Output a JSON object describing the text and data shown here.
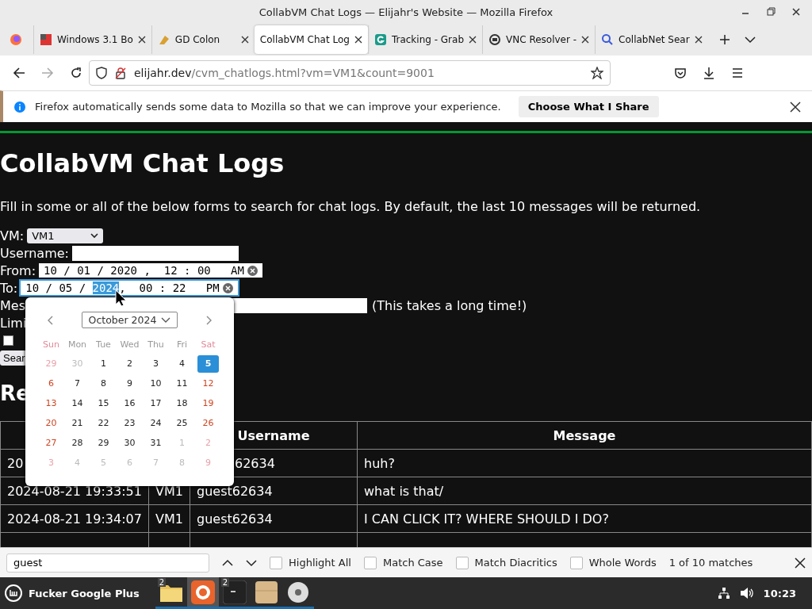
{
  "window": {
    "title": "CollabVM Chat Logs — Elijahr's Website — Mozilla Firefox"
  },
  "tabs": [
    {
      "label": "Windows 3.1 Bo",
      "selected": false
    },
    {
      "label": "GD Colon",
      "selected": false
    },
    {
      "label": "CollabVM Chat Log",
      "selected": true
    },
    {
      "label": "Tracking - Grab",
      "selected": false
    },
    {
      "label": "VNC Resolver -",
      "selected": false
    },
    {
      "label": "CollabNet Sear",
      "selected": false
    }
  ],
  "address": {
    "host": "elijahr.dev",
    "path": "/cvm_chatlogs.html?vm=VM1&count=9001"
  },
  "notification": {
    "text": "Firefox automatically sends some data to Mozilla so that we can improve your experience.",
    "button": "Choose What I Share"
  },
  "page": {
    "title": "CollabVM Chat Logs",
    "intro": "Fill in some or all of the below forms to search for chat logs. By default, the last 10 messages will be returned.",
    "vm_label": "VM:",
    "vm_value": "VM1",
    "username_label": "Username:",
    "from_label": "From:",
    "from_value": "10 / 01 / 2020 ,  12 : 00   AM",
    "to_label": "To:",
    "to_before": "10 / 05 / ",
    "to_highlight": "2024",
    "to_after": ",  00 : 22   PM",
    "message_label": "Mes",
    "message_note": "(This takes a long time!)",
    "limit_label": "Limi",
    "checked": false,
    "search_button": "Sear",
    "results_heading": "Re"
  },
  "calendar": {
    "month": "October 2024",
    "weekdays": [
      {
        "label": "Sun",
        "weekend": true
      },
      {
        "label": "Mon",
        "weekend": false
      },
      {
        "label": "Tue",
        "weekend": false
      },
      {
        "label": "Wed",
        "weekend": false
      },
      {
        "label": "Thu",
        "weekend": false
      },
      {
        "label": "Fri",
        "weekend": false
      },
      {
        "label": "Sat",
        "weekend": true
      }
    ],
    "weeks": [
      [
        {
          "day": "29",
          "muted": true,
          "selected": false
        },
        {
          "day": "30",
          "muted": true,
          "selected": false
        },
        {
          "day": "1",
          "muted": false,
          "selected": false
        },
        {
          "day": "2",
          "muted": false,
          "selected": false
        },
        {
          "day": "3",
          "muted": false,
          "selected": false
        },
        {
          "day": "4",
          "muted": false,
          "selected": false
        },
        {
          "day": "5",
          "muted": false,
          "selected": true
        }
      ],
      [
        {
          "day": "6",
          "muted": false,
          "selected": false
        },
        {
          "day": "7",
          "muted": false,
          "selected": false
        },
        {
          "day": "8",
          "muted": false,
          "selected": false
        },
        {
          "day": "9",
          "muted": false,
          "selected": false
        },
        {
          "day": "10",
          "muted": false,
          "selected": false
        },
        {
          "day": "11",
          "muted": false,
          "selected": false
        },
        {
          "day": "12",
          "muted": false,
          "selected": false
        }
      ],
      [
        {
          "day": "13",
          "muted": false,
          "selected": false
        },
        {
          "day": "14",
          "muted": false,
          "selected": false
        },
        {
          "day": "15",
          "muted": false,
          "selected": false
        },
        {
          "day": "16",
          "muted": false,
          "selected": false
        },
        {
          "day": "17",
          "muted": false,
          "selected": false
        },
        {
          "day": "18",
          "muted": false,
          "selected": false
        },
        {
          "day": "19",
          "muted": false,
          "selected": false
        }
      ],
      [
        {
          "day": "20",
          "muted": false,
          "selected": false
        },
        {
          "day": "21",
          "muted": false,
          "selected": false
        },
        {
          "day": "22",
          "muted": false,
          "selected": false
        },
        {
          "day": "23",
          "muted": false,
          "selected": false
        },
        {
          "day": "24",
          "muted": false,
          "selected": false
        },
        {
          "day": "25",
          "muted": false,
          "selected": false
        },
        {
          "day": "26",
          "muted": false,
          "selected": false
        }
      ],
      [
        {
          "day": "27",
          "muted": false,
          "selected": false
        },
        {
          "day": "28",
          "muted": false,
          "selected": false
        },
        {
          "day": "29",
          "muted": false,
          "selected": false
        },
        {
          "day": "30",
          "muted": false,
          "selected": false
        },
        {
          "day": "31",
          "muted": false,
          "selected": false
        },
        {
          "day": "1",
          "muted": true,
          "selected": false
        },
        {
          "day": "2",
          "muted": true,
          "selected": false
        }
      ],
      [
        {
          "day": "3",
          "muted": true,
          "selected": false
        },
        {
          "day": "4",
          "muted": true,
          "selected": false
        },
        {
          "day": "5",
          "muted": true,
          "selected": false
        },
        {
          "day": "6",
          "muted": true,
          "selected": false
        },
        {
          "day": "7",
          "muted": true,
          "selected": false
        },
        {
          "day": "8",
          "muted": true,
          "selected": false
        },
        {
          "day": "9",
          "muted": true,
          "selected": false
        }
      ]
    ]
  },
  "table": {
    "columns": [
      "",
      "",
      "Username",
      "Message"
    ],
    "rows": [
      [
        "20",
        "",
        "62634",
        "huh?"
      ],
      [
        "2024-08-21 19:33:51",
        "VM1",
        "guest62634",
        "what is that/"
      ],
      [
        "2024-08-21 19:34:07",
        "VM1",
        "guest62634",
        "I CAN CLICK IT? WHERE SHOULD I DO?"
      ],
      [
        "",
        "",
        "",
        ""
      ]
    ]
  },
  "find_bar": {
    "query": "guest",
    "options": [
      {
        "label": "Highlight All",
        "checked": false
      },
      {
        "label": "Match Case",
        "checked": false
      },
      {
        "label": "Match Diacritics",
        "checked": false
      },
      {
        "label": "Whole Words",
        "checked": false
      }
    ],
    "status": "1 of 10 matches"
  },
  "taskbar": {
    "menu_label": "Fucker Google Plus",
    "apps": [
      {
        "kind": "folder",
        "badge": "2",
        "active": false
      },
      {
        "kind": "firefox",
        "active": true
      },
      {
        "kind": "terminal",
        "badge": "2",
        "active": false
      },
      {
        "kind": "box",
        "active": false
      },
      {
        "kind": "disc",
        "active": false
      }
    ],
    "clock": "10:23"
  }
}
